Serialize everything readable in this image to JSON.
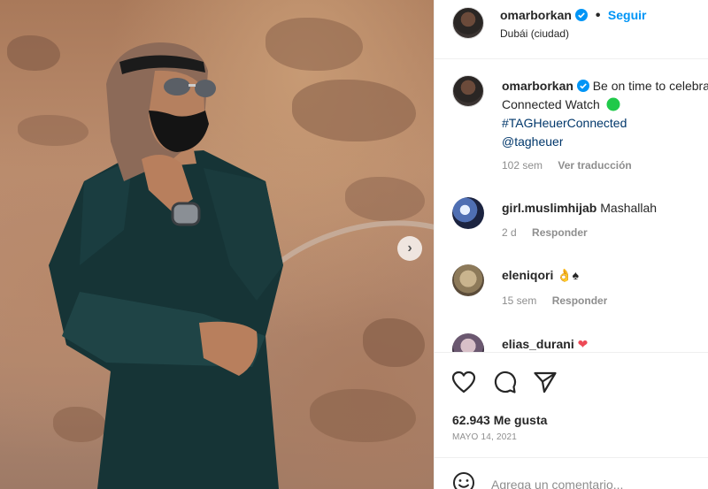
{
  "post": {
    "username": "omarborkan",
    "follow_label": "Seguir",
    "location": "Dubái (ciudad)",
    "separator": "•"
  },
  "caption": {
    "username": "omarborkan",
    "line1": "Be on time to celebrate",
    "line2": "Connected Watch",
    "hashtag": "#TAGHeuerConnected",
    "mention": "@tagheuer",
    "time": "102 sem",
    "translate_label": "Ver traducción"
  },
  "comments": [
    {
      "username": "girl.muslimhijab",
      "text": "Mashallah",
      "time": "2 d",
      "reply_label": "Responder"
    },
    {
      "username": "eleniqori",
      "text": "👌♠",
      "time": "15 sem",
      "reply_label": "Responder"
    },
    {
      "username": "elias_durani",
      "text": "❤"
    }
  ],
  "stats": {
    "likes": "62.943 Me gusta",
    "date": "MAYO 14, 2021"
  },
  "composer": {
    "placeholder": "Agrega un comentario..."
  },
  "icons": {
    "like": "heart-icon",
    "comment": "comment-icon",
    "share": "paper-plane-icon",
    "next": "chevron-right-icon",
    "emoji": "emoji-icon",
    "verified": "verified-badge-icon"
  },
  "colors": {
    "link_blue": "#0095f6",
    "hashtag_blue": "#00376b",
    "muted": "#8e8e8e",
    "verified": "#0095f6",
    "online_green": "#20c94a",
    "heart_red": "#ed4956"
  }
}
